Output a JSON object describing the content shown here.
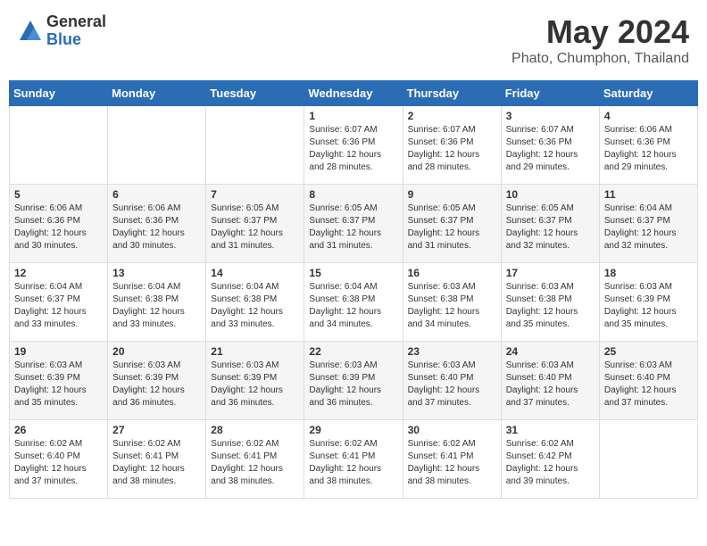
{
  "header": {
    "logo_general": "General",
    "logo_blue": "Blue",
    "month_year": "May 2024",
    "location": "Phato, Chumphon, Thailand"
  },
  "weekdays": [
    "Sunday",
    "Monday",
    "Tuesday",
    "Wednesday",
    "Thursday",
    "Friday",
    "Saturday"
  ],
  "weeks": [
    [
      {
        "day": "",
        "info": ""
      },
      {
        "day": "",
        "info": ""
      },
      {
        "day": "",
        "info": ""
      },
      {
        "day": "1",
        "info": "Sunrise: 6:07 AM\nSunset: 6:36 PM\nDaylight: 12 hours\nand 28 minutes."
      },
      {
        "day": "2",
        "info": "Sunrise: 6:07 AM\nSunset: 6:36 PM\nDaylight: 12 hours\nand 28 minutes."
      },
      {
        "day": "3",
        "info": "Sunrise: 6:07 AM\nSunset: 6:36 PM\nDaylight: 12 hours\nand 29 minutes."
      },
      {
        "day": "4",
        "info": "Sunrise: 6:06 AM\nSunset: 6:36 PM\nDaylight: 12 hours\nand 29 minutes."
      }
    ],
    [
      {
        "day": "5",
        "info": "Sunrise: 6:06 AM\nSunset: 6:36 PM\nDaylight: 12 hours\nand 30 minutes."
      },
      {
        "day": "6",
        "info": "Sunrise: 6:06 AM\nSunset: 6:36 PM\nDaylight: 12 hours\nand 30 minutes."
      },
      {
        "day": "7",
        "info": "Sunrise: 6:05 AM\nSunset: 6:37 PM\nDaylight: 12 hours\nand 31 minutes."
      },
      {
        "day": "8",
        "info": "Sunrise: 6:05 AM\nSunset: 6:37 PM\nDaylight: 12 hours\nand 31 minutes."
      },
      {
        "day": "9",
        "info": "Sunrise: 6:05 AM\nSunset: 6:37 PM\nDaylight: 12 hours\nand 31 minutes."
      },
      {
        "day": "10",
        "info": "Sunrise: 6:05 AM\nSunset: 6:37 PM\nDaylight: 12 hours\nand 32 minutes."
      },
      {
        "day": "11",
        "info": "Sunrise: 6:04 AM\nSunset: 6:37 PM\nDaylight: 12 hours\nand 32 minutes."
      }
    ],
    [
      {
        "day": "12",
        "info": "Sunrise: 6:04 AM\nSunset: 6:37 PM\nDaylight: 12 hours\nand 33 minutes."
      },
      {
        "day": "13",
        "info": "Sunrise: 6:04 AM\nSunset: 6:38 PM\nDaylight: 12 hours\nand 33 minutes."
      },
      {
        "day": "14",
        "info": "Sunrise: 6:04 AM\nSunset: 6:38 PM\nDaylight: 12 hours\nand 33 minutes."
      },
      {
        "day": "15",
        "info": "Sunrise: 6:04 AM\nSunset: 6:38 PM\nDaylight: 12 hours\nand 34 minutes."
      },
      {
        "day": "16",
        "info": "Sunrise: 6:03 AM\nSunset: 6:38 PM\nDaylight: 12 hours\nand 34 minutes."
      },
      {
        "day": "17",
        "info": "Sunrise: 6:03 AM\nSunset: 6:38 PM\nDaylight: 12 hours\nand 35 minutes."
      },
      {
        "day": "18",
        "info": "Sunrise: 6:03 AM\nSunset: 6:39 PM\nDaylight: 12 hours\nand 35 minutes."
      }
    ],
    [
      {
        "day": "19",
        "info": "Sunrise: 6:03 AM\nSunset: 6:39 PM\nDaylight: 12 hours\nand 35 minutes."
      },
      {
        "day": "20",
        "info": "Sunrise: 6:03 AM\nSunset: 6:39 PM\nDaylight: 12 hours\nand 36 minutes."
      },
      {
        "day": "21",
        "info": "Sunrise: 6:03 AM\nSunset: 6:39 PM\nDaylight: 12 hours\nand 36 minutes."
      },
      {
        "day": "22",
        "info": "Sunrise: 6:03 AM\nSunset: 6:39 PM\nDaylight: 12 hours\nand 36 minutes."
      },
      {
        "day": "23",
        "info": "Sunrise: 6:03 AM\nSunset: 6:40 PM\nDaylight: 12 hours\nand 37 minutes."
      },
      {
        "day": "24",
        "info": "Sunrise: 6:03 AM\nSunset: 6:40 PM\nDaylight: 12 hours\nand 37 minutes."
      },
      {
        "day": "25",
        "info": "Sunrise: 6:03 AM\nSunset: 6:40 PM\nDaylight: 12 hours\nand 37 minutes."
      }
    ],
    [
      {
        "day": "26",
        "info": "Sunrise: 6:02 AM\nSunset: 6:40 PM\nDaylight: 12 hours\nand 37 minutes."
      },
      {
        "day": "27",
        "info": "Sunrise: 6:02 AM\nSunset: 6:41 PM\nDaylight: 12 hours\nand 38 minutes."
      },
      {
        "day": "28",
        "info": "Sunrise: 6:02 AM\nSunset: 6:41 PM\nDaylight: 12 hours\nand 38 minutes."
      },
      {
        "day": "29",
        "info": "Sunrise: 6:02 AM\nSunset: 6:41 PM\nDaylight: 12 hours\nand 38 minutes."
      },
      {
        "day": "30",
        "info": "Sunrise: 6:02 AM\nSunset: 6:41 PM\nDaylight: 12 hours\nand 38 minutes."
      },
      {
        "day": "31",
        "info": "Sunrise: 6:02 AM\nSunset: 6:42 PM\nDaylight: 12 hours\nand 39 minutes."
      },
      {
        "day": "",
        "info": ""
      }
    ]
  ]
}
